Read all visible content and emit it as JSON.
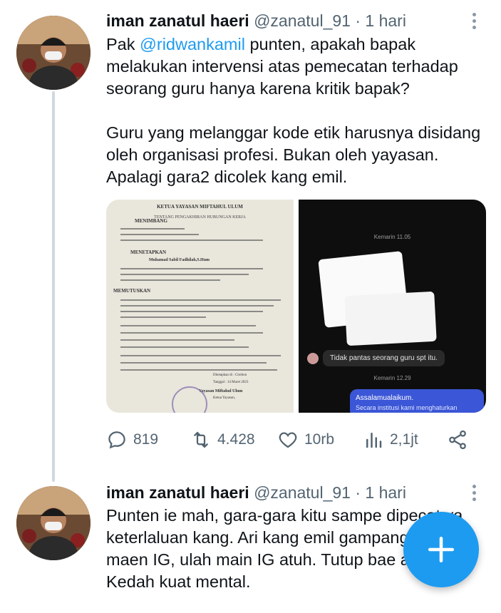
{
  "tweets": [
    {
      "name": "iman zanatul haeri",
      "handle": "@zanatul_91",
      "dot": "·",
      "time": "1 hari",
      "text_pre": "Pak ",
      "mention": "@ridwankamil",
      "text_post": "  punten, apakah bapak melakukan intervensi atas pemecatan terhadap seorang guru hanya karena kritik bapak?",
      "paragraph2": "Guru yang melanggar kode etik harusnya disidang oleh organisasi profesi. Bukan oleh yayasan. Apalagi gara2 dicolek kang emil.",
      "media": {
        "doc_header": "KETUA YAYASAN MIFTAHUL ULUM",
        "doc_subheader": "TENTANG PENGAKHIRAN HUBUNGAN KERJA",
        "doc_sections": [
          "MENIMBANG",
          "MENETAPKAN",
          "MEMUTUSKAN"
        ],
        "doc_name": "Muhamad Sabil Fadhilah,S.Hum",
        "doc_place": "Ditetapkan di : Cirebon",
        "doc_date": "Tanggal : 14 Maret 2023",
        "doc_signature": "Yayasan Miftahul Ulum",
        "doc_role": "Ketua Yayasan,",
        "chat_time1": "Kemarin 11.05",
        "chat_reply": "Tidak pantas seorang guru spt itu.",
        "chat_time2": "Kemarin 12.29",
        "chat_msg1": "Assalamualaikum.",
        "chat_msg2": "Secara institusi kami menghaturkan"
      },
      "stats": {
        "replies": "819",
        "retweets": "4.428",
        "likes": "10rb",
        "views": "2,1jt"
      }
    },
    {
      "name": "iman zanatul haeri",
      "handle": "@zanatul_91",
      "dot": "·",
      "time": "1 hari",
      "lines": [
        "Punten ie mah, gara-gara kitu sampe dipecat ya",
        "keterlaluan kang. Ari kang emil gampang",
        "maen IG, ulah main IG atuh. Tutup bae a",
        "Kedah kuat mental."
      ]
    }
  ],
  "fab": {
    "icon": "plus-icon",
    "color": "#1d9bf0"
  },
  "colors": {
    "mention": "#1d9bf0",
    "muted": "#536471",
    "thread_line": "#cfd9de"
  }
}
